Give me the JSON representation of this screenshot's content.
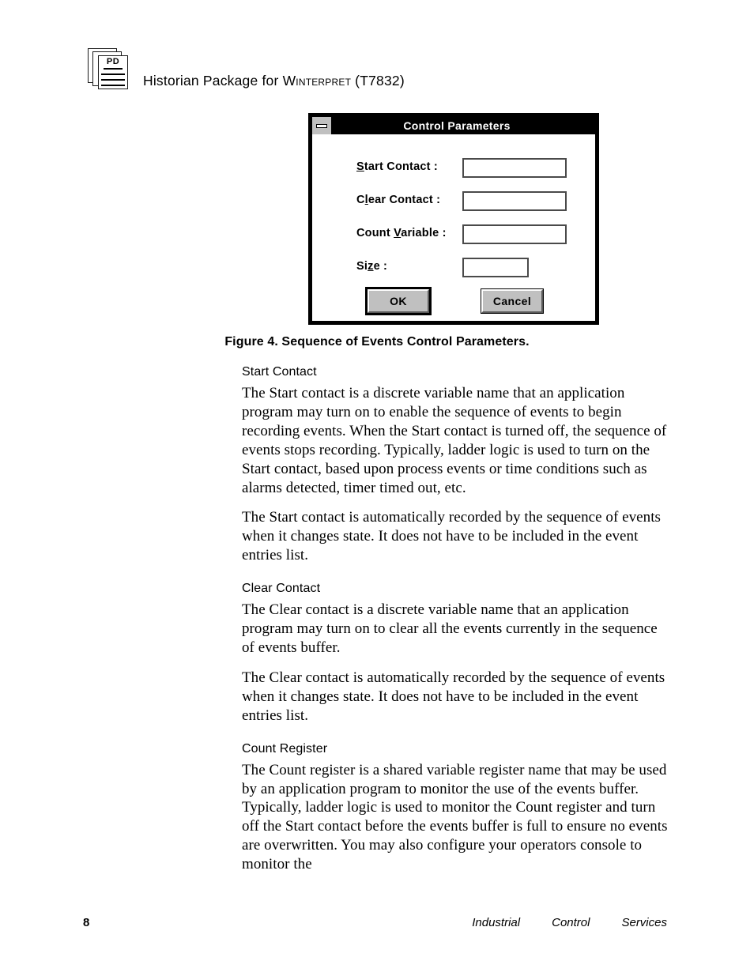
{
  "header": {
    "icon_name": "document-stack-icon",
    "icon_label": "PD",
    "title_main": "Historian  Package  for ",
    "title_smallcaps": "Winterpret",
    "title_suffix": " (T7832)"
  },
  "dialog": {
    "title": "Control Parameters",
    "sysmenu_icon": "minimize-icon",
    "fields": [
      {
        "label_pre": "",
        "label_mnemonic": "S",
        "label_post": "tart Contact :",
        "value": "",
        "placeholder": "",
        "size": "wide"
      },
      {
        "label_pre": "C",
        "label_mnemonic": "l",
        "label_post": "ear Contact :",
        "value": "",
        "placeholder": "",
        "size": "wide"
      },
      {
        "label_pre": "Count ",
        "label_mnemonic": "V",
        "label_post": "ariable :",
        "value": "",
        "placeholder": "",
        "size": "wide"
      },
      {
        "label_pre": "Si",
        "label_mnemonic": "z",
        "label_post": "e :",
        "value": "",
        "placeholder": "",
        "size": "small"
      }
    ],
    "ok_label": "OK",
    "cancel_label": "Cancel"
  },
  "figure": {
    "caption": "Figure 4.  Sequence of Events Control Parameters."
  },
  "content": {
    "sections": [
      {
        "heading": "Start Contact",
        "paragraphs": [
          "The Start contact is a discrete variable name that an application program may turn on to enable the sequence of events to begin recording events.  When the Start contact is turned off, the sequence of events stops recording.  Typically, ladder logic is used to turn on the Start contact, based upon process events or time conditions such as alarms detected, timer timed out, etc.",
          "The Start contact is automatically recorded by the sequence of events when it changes state.  It does not have to be included in the event entries list."
        ]
      },
      {
        "heading": "Clear Contact",
        "paragraphs": [
          "The Clear contact is a discrete variable name that an application program may turn on to clear all the events currently in the sequence of events buffer.",
          "The Clear contact is automatically recorded by the sequence of events when it changes state.  It does not have to be included in the event entries list."
        ]
      },
      {
        "heading": "Count Register",
        "paragraphs": [
          "The Count register is a shared variable register name that may be used by an application program to monitor the use of the events buffer.  Typically, ladder logic is used to monitor the Count register and turn off the Start contact before the events buffer is full to ensure no events are overwritten.  You may also configure your operators console to monitor the"
        ]
      }
    ]
  },
  "footer": {
    "page_number": "8",
    "brand_word1": "Industrial",
    "brand_word2": "Control",
    "brand_word3": "Services"
  }
}
